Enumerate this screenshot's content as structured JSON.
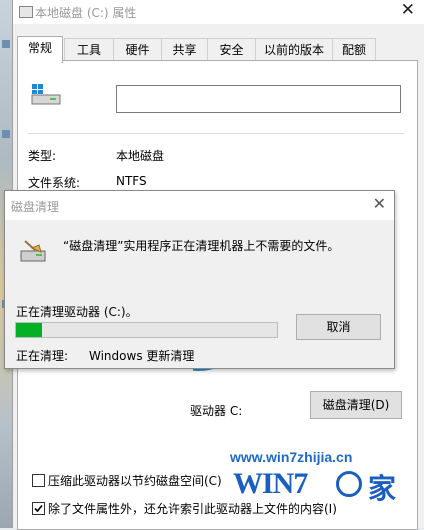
{
  "properties_window": {
    "title": "本地磁盘 (C:) 属性",
    "close_glyph": "✕",
    "tabs": [
      "常规",
      "工具",
      "硬件",
      "共享",
      "安全",
      "以前的版本",
      "配额"
    ],
    "active_tab": "常规",
    "drive_icon": "drive-icon",
    "name_value": "",
    "type_label": "类型:",
    "type_value": "本地磁盘",
    "fs_label": "文件系统:",
    "fs_value": "NTFS",
    "drive_label": "驱动器 C:",
    "cleanup_button": "磁盘清理(D)",
    "compress_label": "压缩此驱动器以节约磁盘空间(C)",
    "compress_checked": false,
    "index_label": "除了文件属性外，还允许索引此驱动器上文件的内容(I)",
    "index_checked": true,
    "pie_color": "#2b8dd0"
  },
  "cleanup_dialog": {
    "title": "磁盘清理",
    "close_glyph": "✕",
    "message": "“磁盘清理”实用程序正在清理机器上不需要的文件。",
    "status_line": "正在清理驱动器 (C:)。",
    "progress": 0.1,
    "progress_color": "#06b025",
    "cancel_label": "取消",
    "cleaning_label": "正在清理:",
    "cleaning_value": "Windows 更新清理"
  },
  "watermark": {
    "url": "www.win7zhijia.cn",
    "logo_text": "WIN7",
    "logo_suffix": "家"
  }
}
